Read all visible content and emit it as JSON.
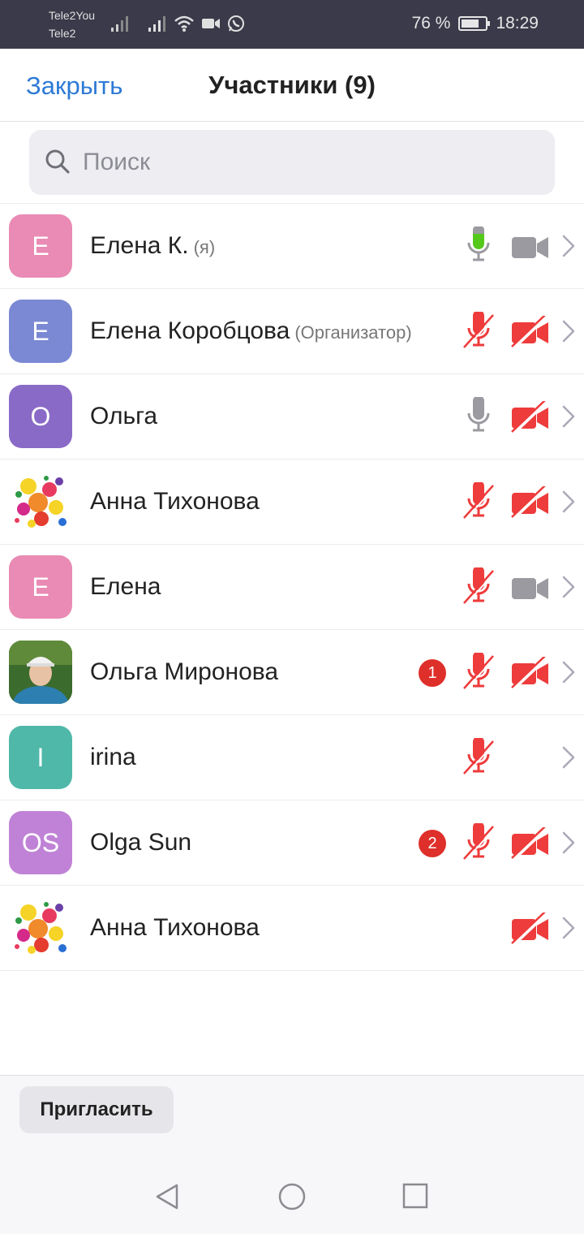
{
  "status_bar": {
    "carrier1": "Tele2You",
    "carrier2": "Tele2",
    "battery": "76 %",
    "battery_level": 0.76,
    "time": "18:29",
    "icons": [
      "signal-icon",
      "signal-icon",
      "wifi-icon",
      "video-call-icon",
      "whatsapp-icon",
      "battery-icon"
    ]
  },
  "header": {
    "close_label": "Закрыть",
    "title": "Участники (9)"
  },
  "search": {
    "placeholder": "Поиск"
  },
  "participants": [
    {
      "initials": "E",
      "avatar_type": "initials",
      "avatar_color": "#e98bb4",
      "name": "Елена К.",
      "role": "(я)",
      "badge": "",
      "mic": "active",
      "cam": "on"
    },
    {
      "initials": "E",
      "avatar_type": "initials",
      "avatar_color": "#7b88d3",
      "name": "Елена Коробцова",
      "role": "(Организатор)",
      "badge": "",
      "mic": "muted",
      "cam": "off"
    },
    {
      "initials": "O",
      "avatar_type": "initials",
      "avatar_color": "#8a6ac7",
      "name": "Ольга",
      "role": "",
      "badge": "",
      "mic": "on",
      "cam": "off"
    },
    {
      "initials": "",
      "avatar_type": "photo-flowers",
      "avatar_color": "#ffffff",
      "name": "Анна Тихонова",
      "role": "",
      "badge": "",
      "mic": "muted",
      "cam": "off"
    },
    {
      "initials": "E",
      "avatar_type": "initials",
      "avatar_color": "#e98bb4",
      "name": "Елена",
      "role": "",
      "badge": "",
      "mic": "muted",
      "cam": "on"
    },
    {
      "initials": "",
      "avatar_type": "photo-person",
      "avatar_color": "#3b6a2f",
      "name": "Ольга Миронова",
      "role": "",
      "badge": "1",
      "mic": "muted",
      "cam": "off"
    },
    {
      "initials": "I",
      "avatar_type": "initials",
      "avatar_color": "#4fb8a9",
      "name": "irina",
      "role": "",
      "badge": "",
      "mic": "muted",
      "cam": "none"
    },
    {
      "initials": "OS",
      "avatar_type": "initials",
      "avatar_color": "#c082d6",
      "name": "Olga Sun",
      "role": "",
      "badge": "2",
      "mic": "muted",
      "cam": "off"
    },
    {
      "initials": "",
      "avatar_type": "photo-flowers",
      "avatar_color": "#ffffff",
      "name": "Анна Тихонова",
      "role": "",
      "badge": "",
      "mic": "none",
      "cam": "off"
    }
  ],
  "colors": {
    "accent": "#2d7ad6",
    "muted_red": "#ee3b3b",
    "active_green": "#55c81c",
    "icon_gray": "#9a9aa0"
  },
  "footer": {
    "invite_label": "Пригласить"
  },
  "nav": {
    "icons": [
      "back-icon",
      "home-icon",
      "recents-icon"
    ]
  }
}
